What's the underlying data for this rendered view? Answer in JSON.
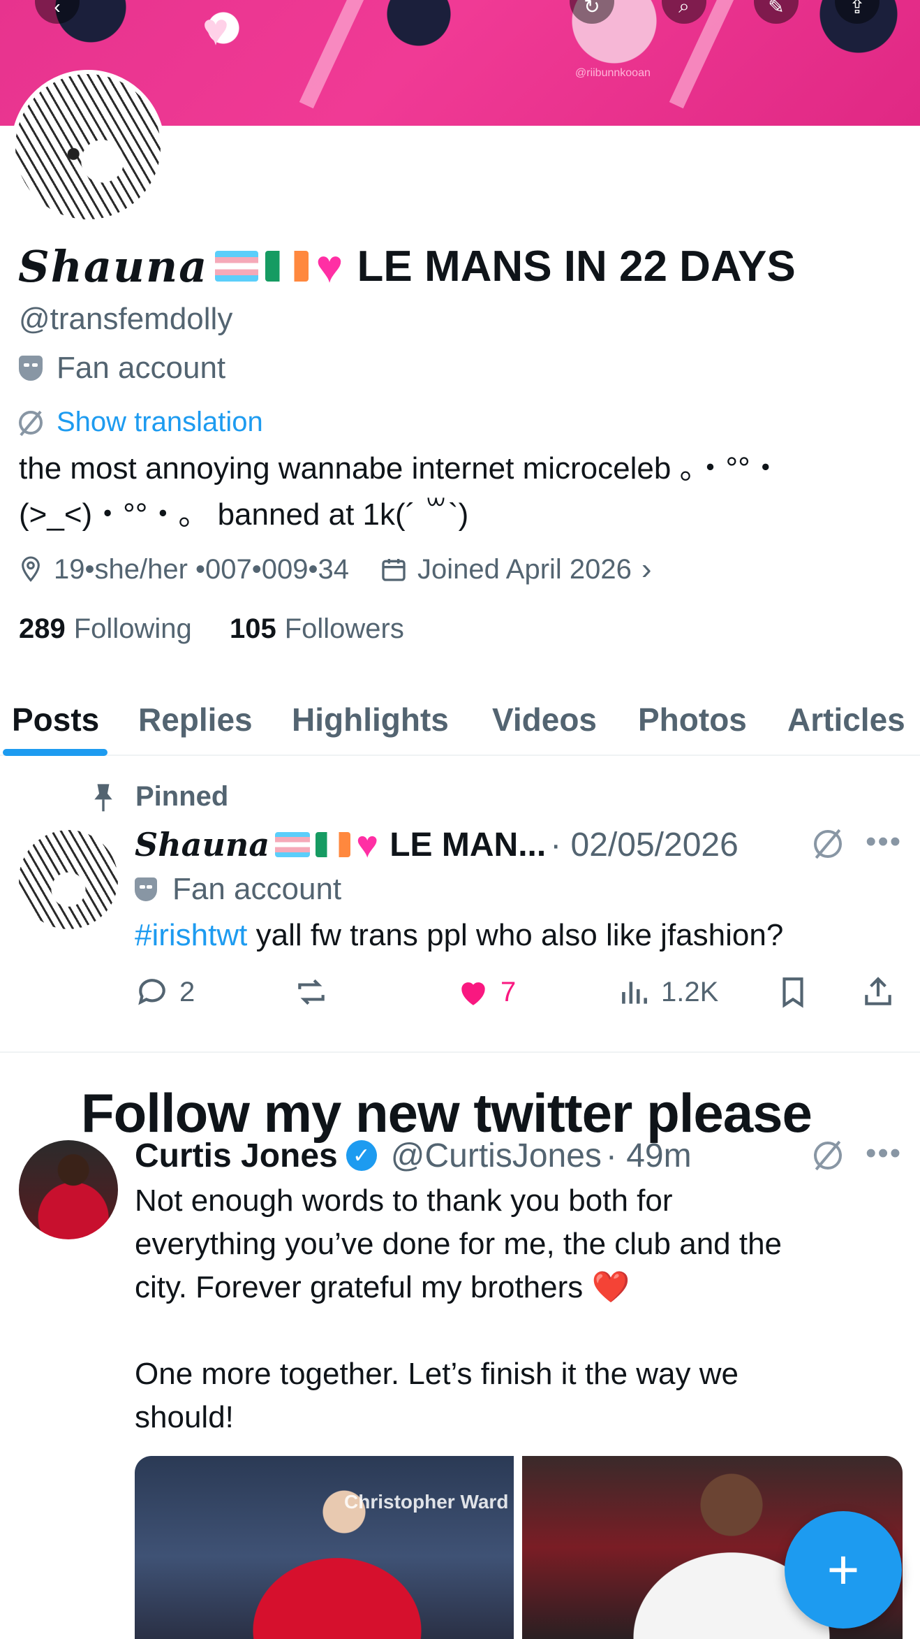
{
  "profile": {
    "name_script": "𝓢𝓱𝓪𝓾𝓷𝓪",
    "name_script_plain": "Shauna",
    "heart": "💗",
    "name_tail": "LE MANS IN 22 DAYS",
    "handle": "@transfemdolly",
    "label": "Fan account",
    "show_translation": "Show translation",
    "bio_line1": "the most annoying wannabe internet microceleb 。・°°・",
    "bio_line2": "(>_<)・°°・。 banned at 1k(´ ꒳`)",
    "location": "19•she/her •007•009•34",
    "joined": "Joined April 2026",
    "following_count": "289",
    "following_label": "Following",
    "followers_count": "105",
    "followers_label": "Followers",
    "banner_watermark": "@riibunnkooan"
  },
  "tabs": [
    {
      "label": "Posts"
    },
    {
      "label": "Replies"
    },
    {
      "label": "Highlights"
    },
    {
      "label": "Videos"
    },
    {
      "label": "Photos"
    },
    {
      "label": "Articles"
    }
  ],
  "pinned_post": {
    "pinned_label": "Pinned",
    "name_script": "Shauna",
    "name_tail": "LE MAN...",
    "date": "· 02/05/2026",
    "label": "Fan account",
    "hashtag": "#irishtwt",
    "text": " yall fw trans ppl who also like jfashion?",
    "replies": "2",
    "likes": "7",
    "views": "1.2K"
  },
  "overlay": {
    "text": "Follow my new twitter please"
  },
  "second_post": {
    "name": "Curtis Jones",
    "handle": "@CurtisJones",
    "time": "· 49m",
    "text_line1": "Not enough words to thank you both for",
    "text_line2": "everything you’ve done for me, the club and the",
    "text_line3": "city. Forever grateful my brothers ❤️",
    "text_line4": "One more together. Let’s finish it the way we",
    "text_line5": "should!",
    "media_board": "Christopher Ward"
  },
  "fab": {
    "icon": "+"
  },
  "colors": {
    "accent": "#1d9bf0",
    "like": "#f91880",
    "muted": "#536471",
    "banner": "#e7338e"
  }
}
